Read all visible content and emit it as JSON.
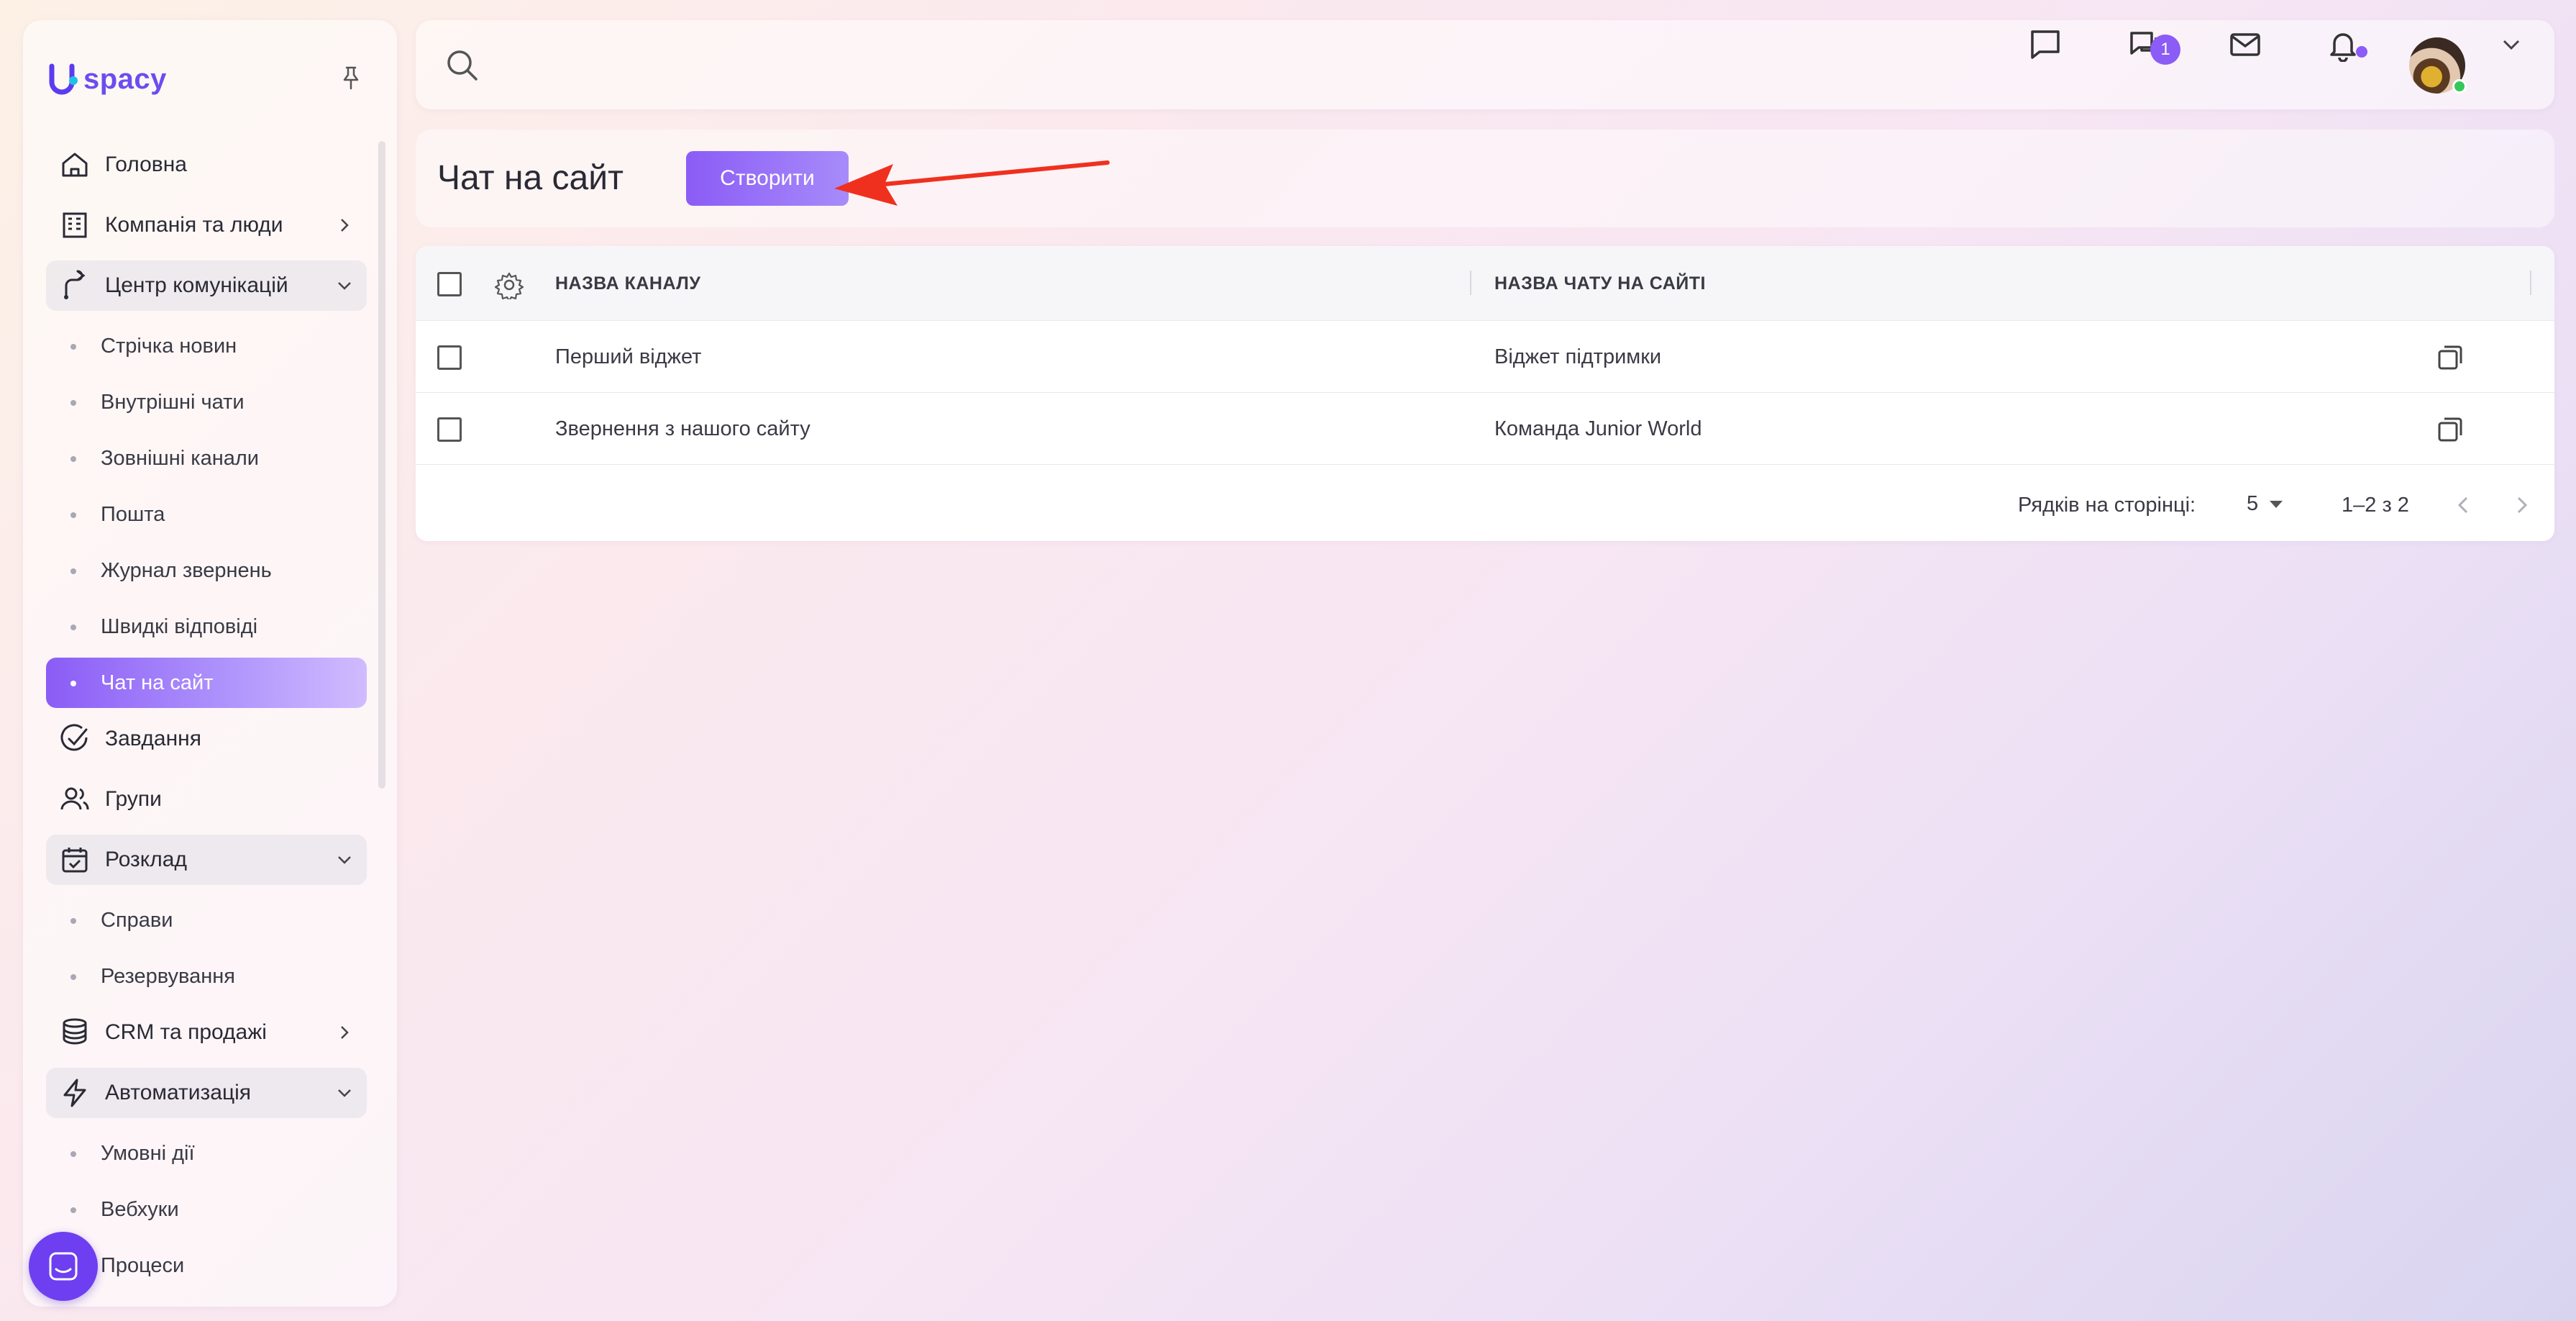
{
  "sidebar": {
    "logo": "spacy",
    "items": [
      {
        "label": "Головна"
      },
      {
        "label": "Компанія та люди"
      },
      {
        "label": "Центр комунікацій"
      },
      {
        "label": "Стрічка новин"
      },
      {
        "label": "Внутрішні чати"
      },
      {
        "label": "Зовнішні канали"
      },
      {
        "label": "Пошта"
      },
      {
        "label": "Журнал звернень"
      },
      {
        "label": "Швидкі відповіді"
      },
      {
        "label": "Чат на сайт"
      },
      {
        "label": "Завдання"
      },
      {
        "label": "Групи"
      },
      {
        "label": "Розклад"
      },
      {
        "label": "Справи"
      },
      {
        "label": "Резервування"
      },
      {
        "label": "CRM та продажі"
      },
      {
        "label": "Автоматизація"
      },
      {
        "label": "Умовні дії"
      },
      {
        "label": "Вебхуки"
      },
      {
        "label": "Процеси"
      }
    ]
  },
  "topbar": {
    "search_placeholder": "",
    "chat_badge": "1"
  },
  "header": {
    "title": "Чат на сайт",
    "create_label": "Створити"
  },
  "table": {
    "columns": [
      "НАЗВА КАНАЛУ",
      "НАЗВА ЧАТУ НА САЙТІ"
    ],
    "rows": [
      {
        "channel": "Перший віджет",
        "chat": "Віджет підтримки"
      },
      {
        "channel": "Звернення з нашого сайту",
        "chat": "Команда Junior World"
      }
    ],
    "footer": {
      "rows_per_page_label": "Рядків на сторінці:",
      "rows_per_page": "5",
      "range": "1–2 з 2"
    }
  },
  "colors": {
    "accent": "#8b5cf6",
    "arrow": "#f0301e",
    "online": "#34c759"
  }
}
